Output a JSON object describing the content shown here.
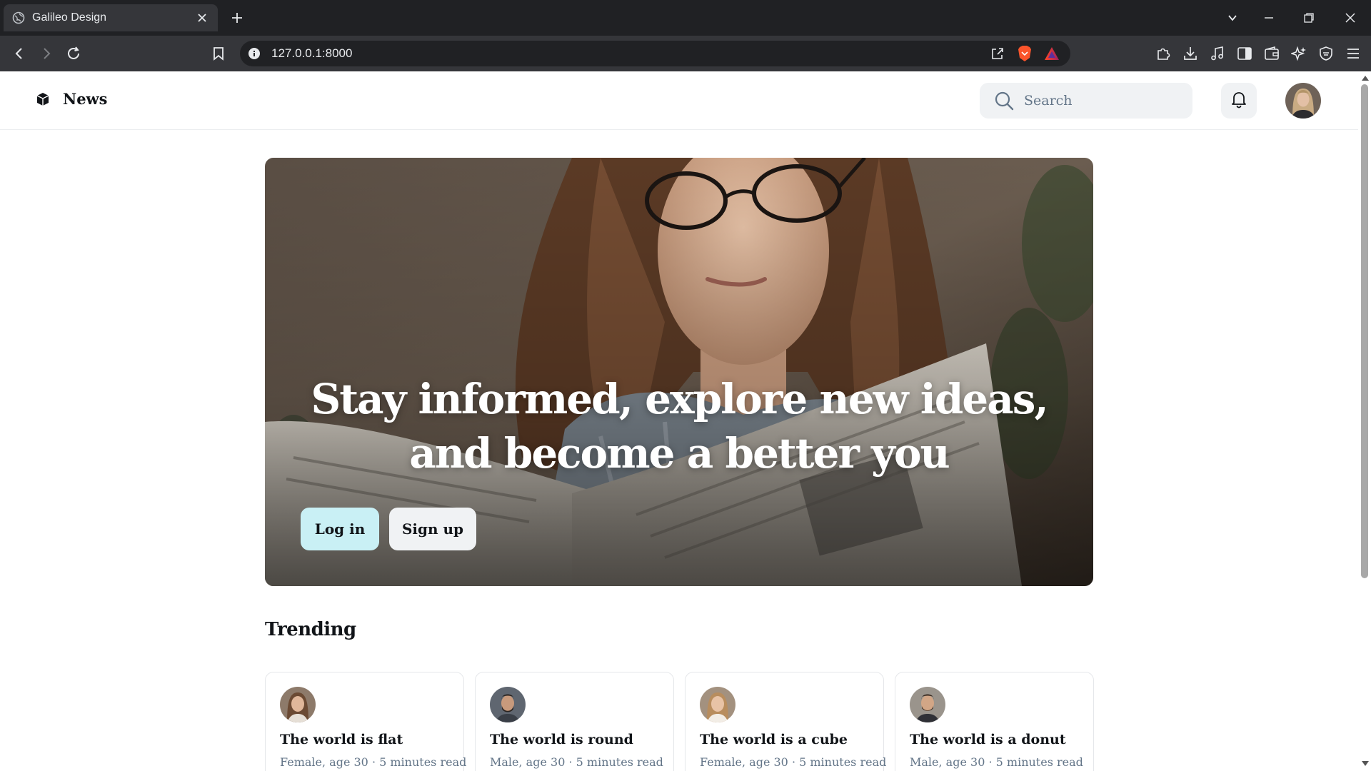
{
  "browser": {
    "tab_title": "Galileo Design",
    "url": "127.0.0.1:8000"
  },
  "header": {
    "brand_name": "News",
    "search_placeholder": "Search"
  },
  "hero": {
    "title": "Stay informed, explore new ideas, and become a better you",
    "login_label": "Log in",
    "signup_label": "Sign up"
  },
  "trending": {
    "title": "Trending",
    "cards": [
      {
        "title": "The world is flat",
        "meta": "Female, age 30 · 5 minutes read"
      },
      {
        "title": "The world is round",
        "meta": "Male, age 30 · 5 minutes read"
      },
      {
        "title": "The world is a cube",
        "meta": "Female, age 30 · 5 minutes read"
      },
      {
        "title": "The world is a donut",
        "meta": "Male, age 30 · 5 minutes read"
      }
    ]
  },
  "colors": {
    "accent_login": "#c9f0f5",
    "neutral_button": "#f0f2f4",
    "text_primary": "#111418",
    "text_secondary": "#637588"
  }
}
